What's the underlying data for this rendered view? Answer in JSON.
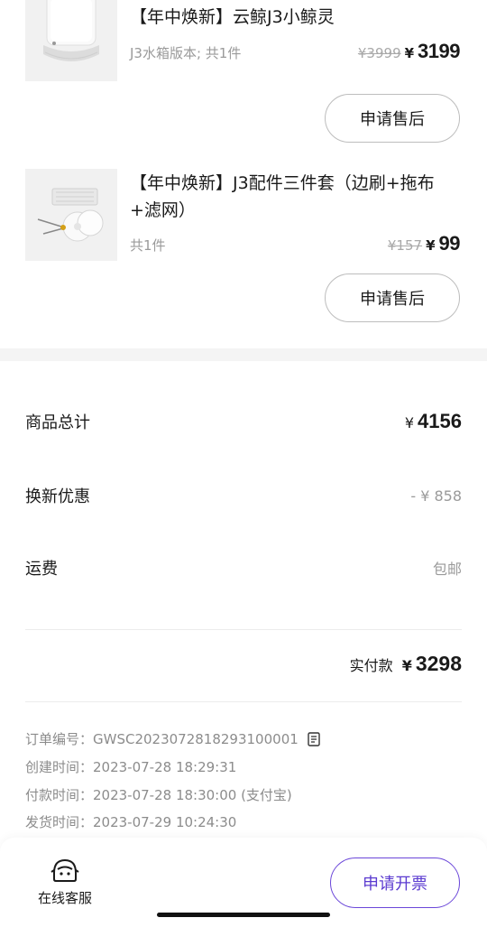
{
  "products": [
    {
      "title": "【年中焕新】云鲸J3小鲸灵",
      "spec": "J3水箱版本; 共1件",
      "old_price": "¥3999",
      "currency": "¥",
      "price": "3199",
      "button": "申请售后"
    },
    {
      "title": "【年中焕新】J3配件三件套（边刷+拖布+滤网）",
      "spec": "共1件",
      "old_price": "¥157",
      "currency": "¥",
      "price": "99",
      "button": "申请售后"
    }
  ],
  "summary": {
    "total_label": "商品总计",
    "total_currency": "¥",
    "total_value": "4156",
    "discount_label": "换新优惠",
    "discount_value": "- ¥ 858",
    "shipping_label": "运费",
    "shipping_value": "包邮",
    "paid_label": "实付款",
    "paid_currency": "¥",
    "paid_value": "3298"
  },
  "order_info": {
    "order_no": "订单编号：GWSC2023072818293100001",
    "created": "创建时间：2023-07-28 18:29:31",
    "paid_time": "付款时间：2023-07-28 18:30:00 (支付宝)",
    "shipped": "发货时间：2023-07-29 10:24:30"
  },
  "bottom_bar": {
    "customer_service": "在线客服",
    "invoice_button": "申请开票"
  },
  "colors": {
    "accent": "#5b3bd0",
    "muted": "#9a9a9a"
  }
}
